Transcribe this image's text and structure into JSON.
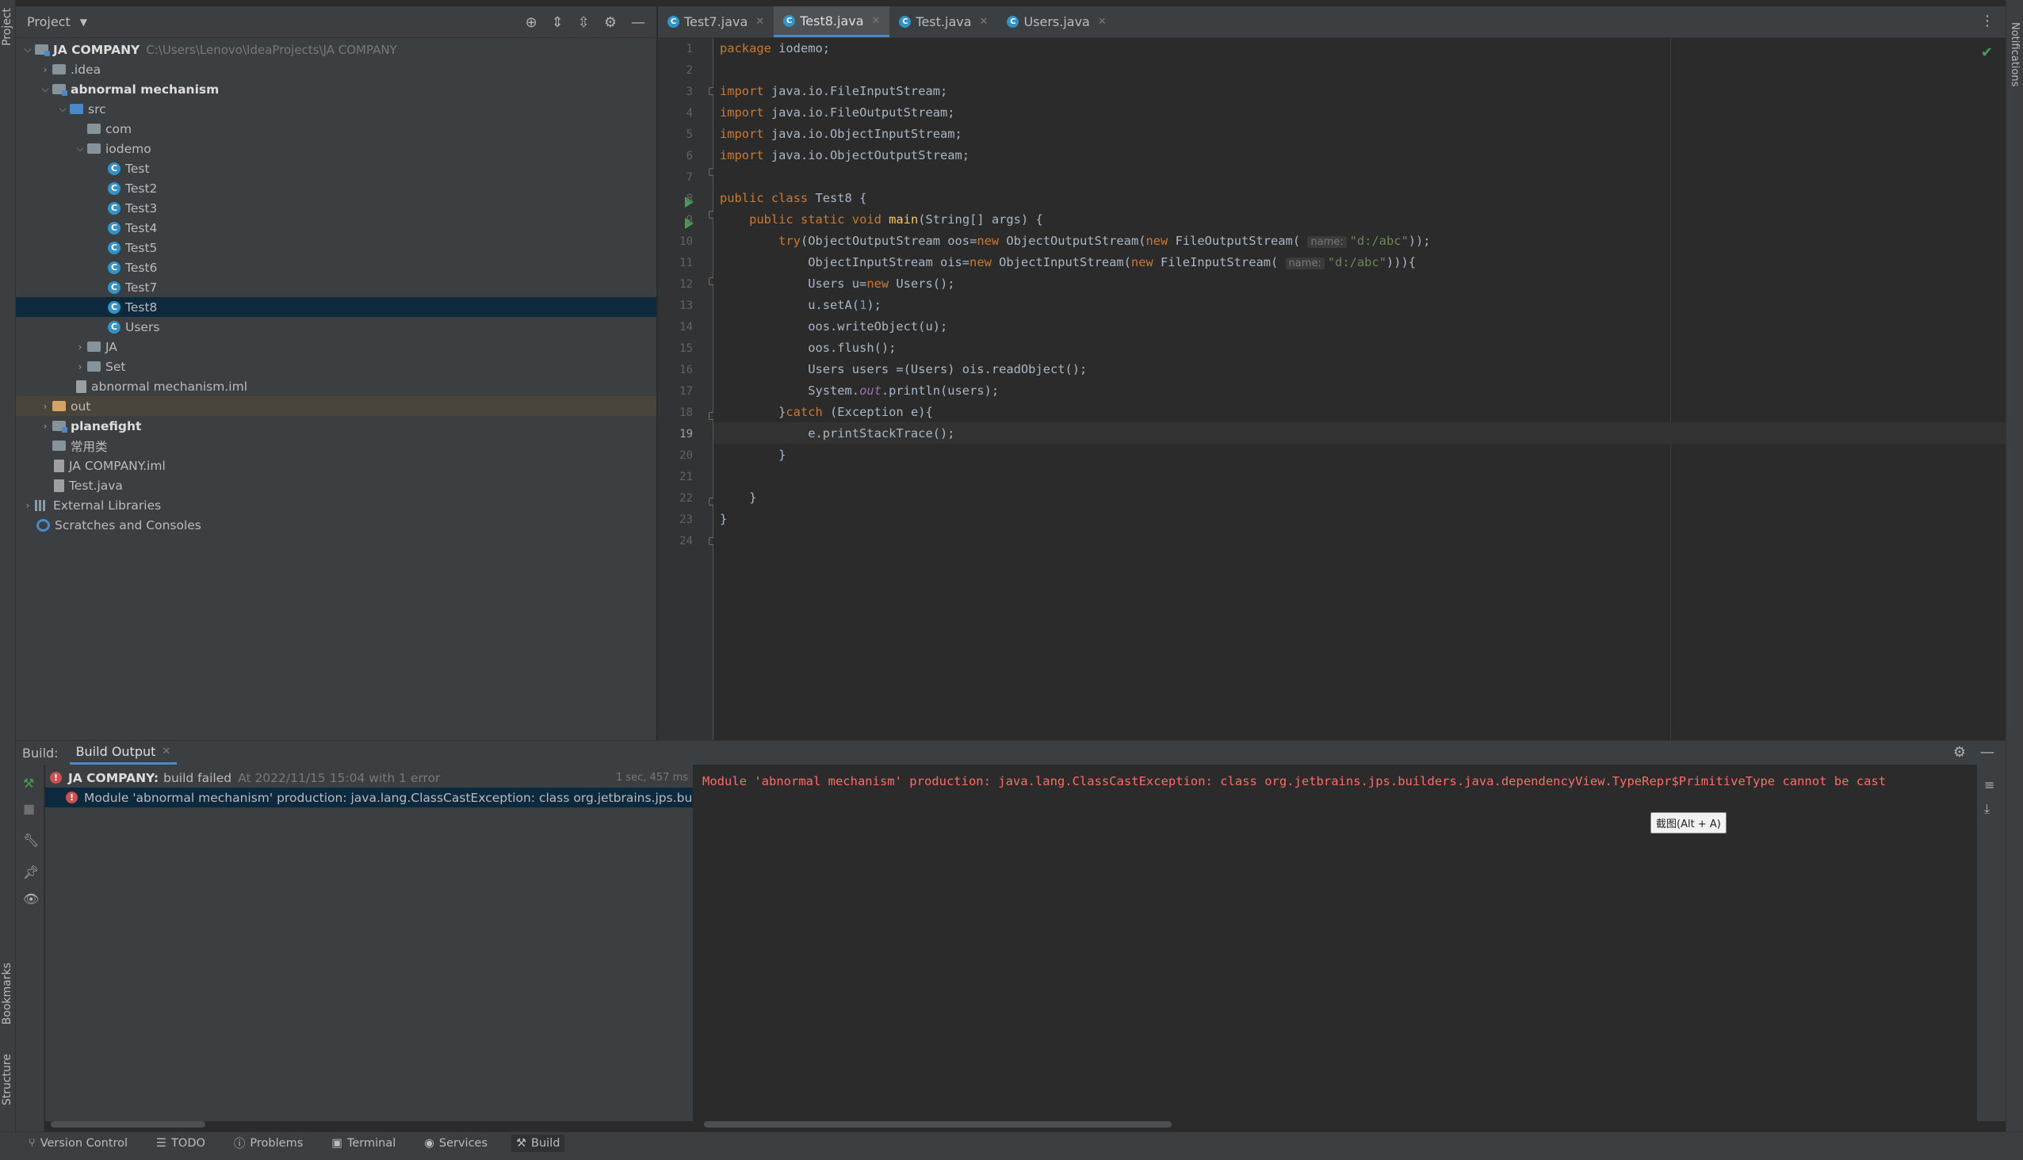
{
  "left_strip": {
    "project": "Project",
    "bookmarks": "Bookmarks",
    "structure": "Structure"
  },
  "right_strip": {
    "notifications": "Notifications"
  },
  "project_panel": {
    "title": "Project",
    "tree": [
      {
        "label": "JA COMPANY",
        "path": "C:\\Users\\Lenovo\\IdeaProjects\\JA COMPANY",
        "bold": true
      },
      {
        "label": ".idea"
      },
      {
        "label": "abnormal mechanism",
        "bold": true
      },
      {
        "label": "src"
      },
      {
        "label": "com"
      },
      {
        "label": "iodemo"
      },
      {
        "label": "Test"
      },
      {
        "label": "Test2"
      },
      {
        "label": "Test3"
      },
      {
        "label": "Test4"
      },
      {
        "label": "Test5"
      },
      {
        "label": "Test6"
      },
      {
        "label": "Test7"
      },
      {
        "label": "Test8"
      },
      {
        "label": "Users"
      },
      {
        "label": "JA"
      },
      {
        "label": "Set"
      },
      {
        "label": "abnormal mechanism.iml"
      },
      {
        "label": "out"
      },
      {
        "label": "planefight",
        "bold": true
      },
      {
        "label": "常用类"
      },
      {
        "label": "JA COMPANY.iml"
      },
      {
        "label": "Test.java"
      },
      {
        "label": "External Libraries"
      },
      {
        "label": "Scratches and Consoles"
      }
    ]
  },
  "tabs": [
    {
      "label": "Test7.java"
    },
    {
      "label": "Test8.java",
      "active": true
    },
    {
      "label": "Test.java"
    },
    {
      "label": "Users.java"
    }
  ],
  "editor": {
    "line_numbers": [
      "1",
      "2",
      "3",
      "4",
      "5",
      "6",
      "7",
      "8",
      "9",
      "10",
      "11",
      "12",
      "13",
      "14",
      "15",
      "16",
      "17",
      "18",
      "19",
      "20",
      "21",
      "22",
      "23",
      "24"
    ],
    "current_line": "19",
    "hint_name": "name:",
    "path_str": "\"d:/abc\""
  },
  "build": {
    "label": "Build:",
    "tab": "Build Output",
    "root_project": "JA COMPANY:",
    "root_status": "build failed",
    "root_time": "At 2022/11/15 15:04 with 1 error",
    "duration": "1 sec, 457 ms",
    "error_item": "Module 'abnormal mechanism' production: java.lang.ClassCastException: class org.jetbrains.jps.builders.ja",
    "console_line": "Module 'abnormal mechanism' production: java.lang.ClassCastException: class org.jetbrains.jps.builders.java.dependencyView.TypeRepr$PrimitiveType cannot be cast",
    "tooltip": "截图(Alt + A)"
  },
  "bottom_tools": [
    {
      "label": "Version Control",
      "icon": "branch-icon"
    },
    {
      "label": "TODO",
      "icon": "list-icon"
    },
    {
      "label": "Problems",
      "icon": "info-icon"
    },
    {
      "label": "Terminal",
      "icon": "terminal-icon"
    },
    {
      "label": "Services",
      "icon": "services-icon"
    },
    {
      "label": "Build",
      "icon": "hammer-icon",
      "active": true
    }
  ]
}
